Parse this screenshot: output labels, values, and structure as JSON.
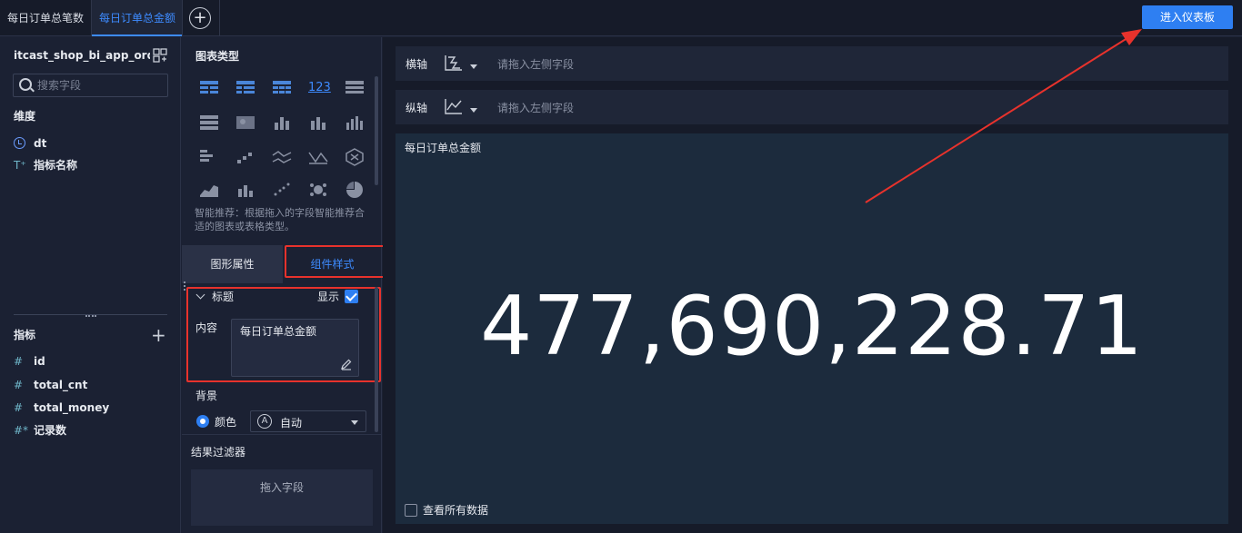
{
  "tabs": [
    {
      "label": "每日订单总笔数",
      "active": false
    },
    {
      "label": "每日订单总金额",
      "active": true
    }
  ],
  "enter_dashboard_label": "进入仪表板",
  "left_panel": {
    "dataset_name": "itcast_shop_bi_app_orde...",
    "search_placeholder": "搜索字段",
    "dimensions_title": "维度",
    "dimensions": [
      {
        "icon": "clock-icon",
        "label": "dt"
      },
      {
        "icon": "text-type-icon",
        "label": "指标名称"
      }
    ],
    "measures_title": "指标",
    "measures": [
      {
        "icon": "hash-icon",
        "label": "id"
      },
      {
        "icon": "hash-icon",
        "label": "total_cnt"
      },
      {
        "icon": "hash-icon",
        "label": "total_money"
      },
      {
        "icon": "hash-star-icon",
        "label": "记录数"
      }
    ]
  },
  "middle_panel": {
    "chart_type_title": "图表类型",
    "recommend_text": "智能推荐：根据拖入的字段智能推荐合适的图表或表格类型。",
    "property_tabs": [
      "图形属性",
      "组件样式"
    ],
    "title_section": "标题",
    "show_label": "显示",
    "content_label": "内容",
    "content_value": "每日订单总金额",
    "background_label": "背景",
    "color_label": "颜色",
    "color_select_value": "自动",
    "result_filter_title": "结果过滤器",
    "drag_field_label": "拖入字段"
  },
  "right_panel": {
    "x_axis_label": "横轴",
    "y_axis_label": "纵轴",
    "axis_placeholder": "请拖入左侧字段",
    "card_title": "每日订单总金额",
    "big_number": "477,690,228.71",
    "view_all_label": "查看所有数据"
  },
  "colors": {
    "accent": "#2e7ff2",
    "highlight_box": "#e8322c",
    "panel_bg": "#1b2133",
    "card_bg": "#1c2b3d"
  }
}
